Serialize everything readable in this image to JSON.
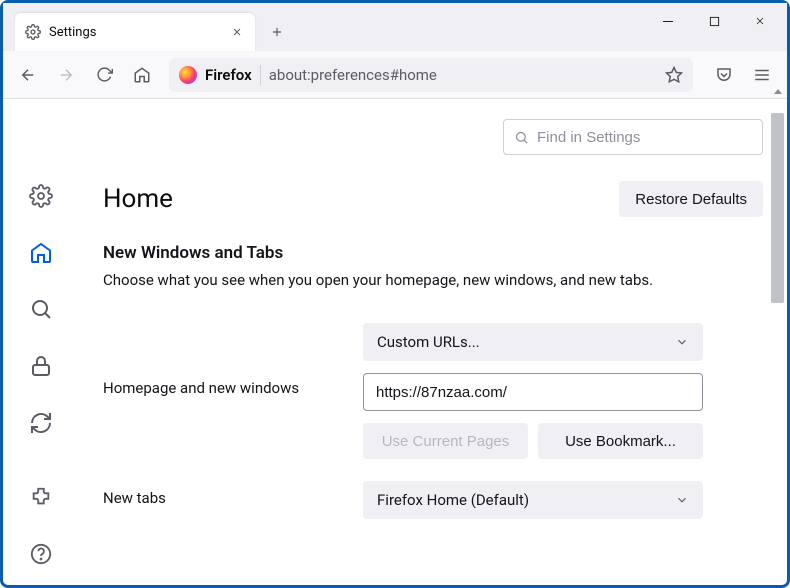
{
  "tab": {
    "title": "Settings"
  },
  "addressbar": {
    "identity": "Firefox",
    "url": "about:preferences#home"
  },
  "search": {
    "placeholder": "Find in Settings"
  },
  "page": {
    "title": "Home",
    "restore": "Restore Defaults",
    "section_heading": "New Windows and Tabs",
    "section_desc": "Choose what you see when you open your homepage, new windows, and new tabs."
  },
  "homepage": {
    "label": "Homepage and new windows",
    "mode": "Custom URLs...",
    "url": "https://87nzaa.com/",
    "use_current": "Use Current Pages",
    "use_bookmark": "Use Bookmark..."
  },
  "newtabs": {
    "label": "New tabs",
    "mode": "Firefox Home (Default)"
  }
}
